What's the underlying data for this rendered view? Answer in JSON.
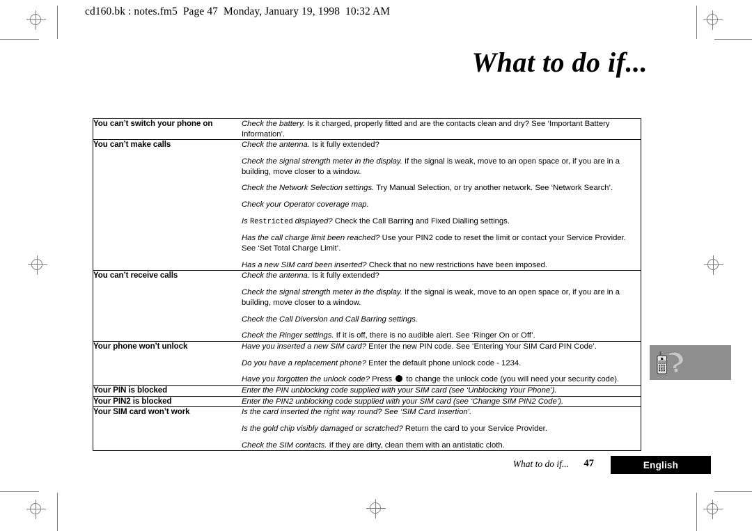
{
  "header": {
    "running_head": "cd160.bk : notes.fm5  Page 47  Monday, January 19, 1998  10:32 AM"
  },
  "title": {
    "chapter": "What to do if..."
  },
  "margin_tab": {
    "icon": "mobile-phone-question-icon",
    "background_color": "#8e8e8e"
  },
  "footer": {
    "title": "What to do if...",
    "page_number": "47",
    "language": "English",
    "language_box_color": "#000000"
  },
  "table": {
    "rows": [
      {
        "problem": "You can’t switch your phone on",
        "solutions": [
          [
            {
              "style": "italic",
              "text": "Check the battery."
            },
            {
              "style": "plain",
              "text": " Is it charged, properly fitted and are the contacts clean and dry? See ‘Important Battery Information’."
            }
          ]
        ]
      },
      {
        "problem": "You can’t make calls",
        "solutions": [
          [
            {
              "style": "italic",
              "text": "Check the antenna."
            },
            {
              "style": "plain",
              "text": " Is it fully extended?"
            }
          ],
          [
            {
              "style": "italic",
              "text": "Check the signal strength meter in the display."
            },
            {
              "style": "plain",
              "text": " If the signal is weak, move to an open space or, if you are in a building, move closer to a window."
            }
          ],
          [
            {
              "style": "italic",
              "text": "Check the Network Selection settings."
            },
            {
              "style": "plain",
              "text": " Try Manual Selection, or try another network. See ‘Network Search’."
            }
          ],
          [
            {
              "style": "italic",
              "text": "Check your Operator coverage map."
            }
          ],
          [
            {
              "style": "italic",
              "text": "Is "
            },
            {
              "style": "mono",
              "text": "Restricted"
            },
            {
              "style": "italic",
              "text": " displayed?"
            },
            {
              "style": "plain",
              "text": " Check the Call Barring and Fixed Dialling settings."
            }
          ],
          [
            {
              "style": "italic",
              "text": "Has the call charge limit been reached?"
            },
            {
              "style": "plain",
              "text": " Use your PIN2 code to reset the limit or contact your Service Provider. See ‘Set Total Charge Limit’."
            }
          ],
          [
            {
              "style": "italic",
              "text": "Has a new SIM card been inserted?"
            },
            {
              "style": "plain",
              "text": " Check that no new restrictions have been imposed."
            }
          ]
        ]
      },
      {
        "problem": "You can’t receive calls",
        "solutions": [
          [
            {
              "style": "italic",
              "text": "Check the antenna."
            },
            {
              "style": "plain",
              "text": " Is it fully extended?"
            }
          ],
          [
            {
              "style": "italic",
              "text": "Check the signal strength meter in the display."
            },
            {
              "style": "plain",
              "text": " If the signal is weak, move to an open space or, if you are in a building, move closer to a window."
            }
          ],
          [
            {
              "style": "italic",
              "text": "Check the Call Diversion and Call Barring settings."
            }
          ],
          [
            {
              "style": "italic",
              "text": "Check the Ringer settings."
            },
            {
              "style": "plain",
              "text": " If it is off, there is no audible alert. See ‘Ringer On or Off’."
            }
          ]
        ]
      },
      {
        "problem": "Your phone won’t unlock",
        "solutions": [
          [
            {
              "style": "italic",
              "text": "Have you inserted a new SIM card?"
            },
            {
              "style": "plain",
              "text": " Enter the new PIN code. See ‘Entering Your SIM Card PIN Code’."
            }
          ],
          [
            {
              "style": "italic",
              "text": "Do you have a replacement phone?"
            },
            {
              "style": "plain",
              "text": " Enter the default phone unlock code - 1234."
            }
          ],
          [
            {
              "style": "italic",
              "text": "Have you forgotten the unlock code?"
            },
            {
              "style": "plain",
              "text": " Press "
            },
            {
              "style": "key",
              "text": "●"
            },
            {
              "style": "plain",
              "text": " to change the unlock code (you will need your security code)."
            }
          ]
        ]
      },
      {
        "problem": "Your PIN is blocked",
        "solutions": [
          [
            {
              "style": "italic",
              "text": "Enter the PIN unblocking code supplied with your SIM card (see ‘Unblocking Your Phone’)."
            }
          ]
        ]
      },
      {
        "problem": "Your PIN2 is blocked",
        "solutions": [
          [
            {
              "style": "italic",
              "text": "Enter the PIN2 unblocking code supplied with your SIM card (see ‘Change SIM PIN2 Code’)."
            }
          ]
        ]
      },
      {
        "problem": "Your SIM card won’t work",
        "solutions": [
          [
            {
              "style": "italic",
              "text": "Is the card inserted the right way round? See ‘SIM Card Insertion’."
            }
          ],
          [
            {
              "style": "italic",
              "text": "Is the gold chip visibly damaged or scratched?"
            },
            {
              "style": "plain",
              "text": " Return the card to your Service Provider."
            }
          ],
          [
            {
              "style": "italic",
              "text": "Check the SIM contacts."
            },
            {
              "style": "plain",
              "text": " If they are dirty, clean them with an antistatic cloth."
            }
          ]
        ]
      }
    ]
  }
}
